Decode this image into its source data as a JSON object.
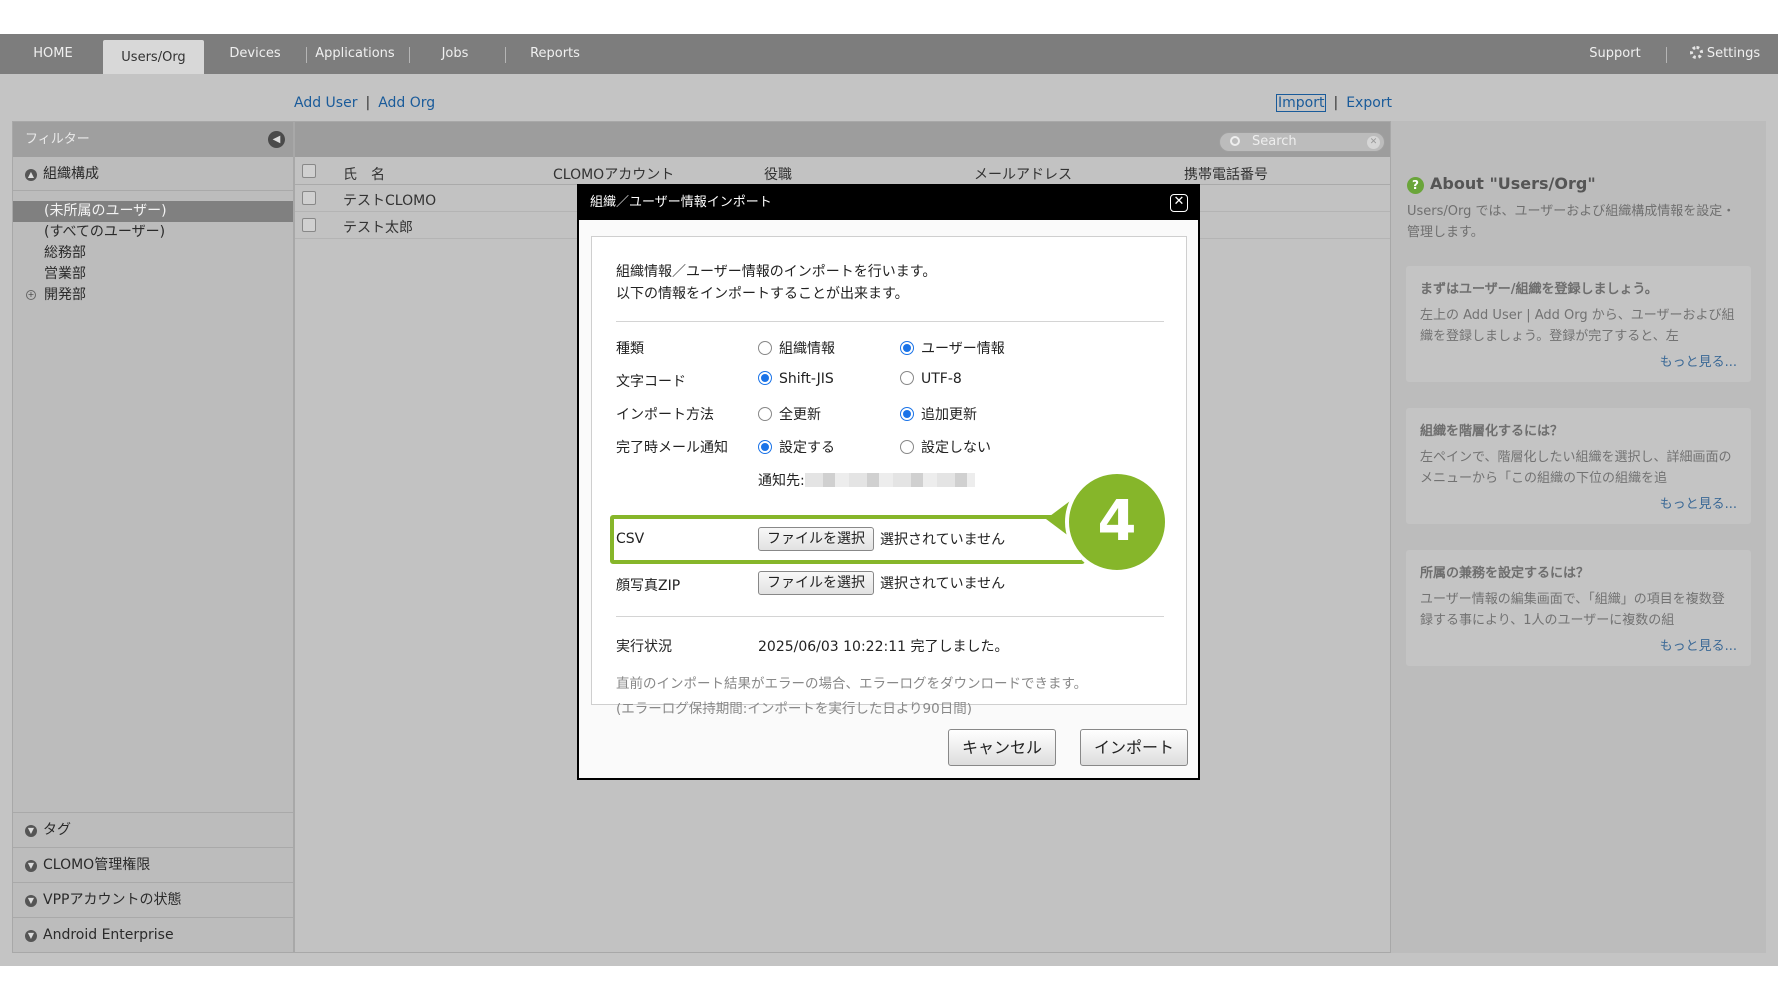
{
  "nav": {
    "home": "HOME",
    "users_org": "Users/Org",
    "devices": "Devices",
    "applications": "Applications",
    "jobs": "Jobs",
    "reports": "Reports",
    "support": "Support",
    "settings": "Settings"
  },
  "toolbar": {
    "add_user": "Add User",
    "add_org": "Add Org",
    "import": "Import",
    "export": "Export",
    "separator": "|"
  },
  "sidebar": {
    "filter_title": "フィルター",
    "section_org": "組織構成",
    "tree": [
      "(未所属のユーザー)",
      "(すべてのユーザー)",
      "総務部",
      "営業部",
      "開発部"
    ],
    "selected_index": 0,
    "bottom_sections": [
      "タグ",
      "CLOMO管理権限",
      "VPPアカウントの状態",
      "Android Enterprise"
    ]
  },
  "list": {
    "search_placeholder": "Search",
    "columns": [
      "氏　名",
      "CLOMOアカウント",
      "役職",
      "メールアドレス",
      "携帯電話番号"
    ],
    "rows": [
      {
        "name": "テストCLOMO"
      },
      {
        "name": "テスト太郎"
      }
    ]
  },
  "about": {
    "title": "About \"Users/Org\"",
    "description": "Users/Org では、ユーザーおよび組織構成情報を設定・管理します。",
    "cards": [
      {
        "title": "まずはユーザー/組織を登録しましょう。",
        "text": "左上の Add User | Add Org から、ユーザーおよび組織を登録しましょう。登録が完了すると、左",
        "more": "もっと見る..."
      },
      {
        "title": "組織を階層化するには？",
        "text": "左ペインで、階層化したい組織を選択し、詳細画面のメニューから「この組織の下位の組織を追",
        "more": "もっと見る..."
      },
      {
        "title": "所属の兼務を設定するには？",
        "text": "ユーザー情報の編集画面で、「組織」の項目を複数登録する事により、1人のユーザーに複数の組",
        "more": "もっと見る..."
      }
    ]
  },
  "modal": {
    "title": "組織／ユーザー情報インポート",
    "intro_line1": "組織情報／ユーザー情報のインポートを行います。",
    "intro_line2": "以下の情報をインポートすることが出来ます。",
    "type_label": "種類",
    "type_opt1": "組織情報",
    "type_opt2": "ユーザー情報",
    "type_selected": "ユーザー情報",
    "encoding_label": "文字コード",
    "encoding_opt1": "Shift-JIS",
    "encoding_opt2": "UTF-8",
    "encoding_selected": "Shift-JIS",
    "method_label": "インポート方法",
    "method_opt1": "全更新",
    "method_opt2": "追加更新",
    "method_selected": "追加更新",
    "mail_label": "完了時メール通知",
    "mail_opt1": "設定する",
    "mail_opt2": "設定しない",
    "mail_selected": "設定する",
    "notify_label": "通知先:",
    "csv_label": "CSV",
    "file_button": "ファイルを選択",
    "file_none": "選択されていません",
    "zip_label": "顔写真ZIP",
    "status_label": "実行状況",
    "status_value": "2025/06/03 10:22:11 完了しました。",
    "note1": "直前のインポート結果がエラーの場合、エラーログをダウンロードできます。",
    "note2": "(エラーログ保持期間:インポートを実行した日より90日間)",
    "cancel": "キャンセル",
    "import": "インポート"
  },
  "callout": {
    "number": "4"
  },
  "colors": {
    "accent_green": "#86b62a",
    "link_blue": "#1a5b9a",
    "radio_blue": "#1a73e8",
    "nav_bg": "#7d7d7d"
  }
}
